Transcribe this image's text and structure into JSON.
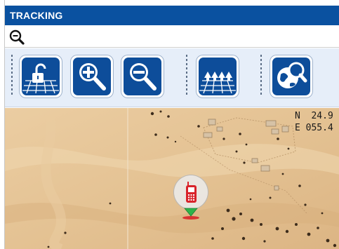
{
  "window": {
    "title": "TRACKING"
  },
  "search": {
    "icon": "magnifier-icon"
  },
  "toolbar": {
    "buttons": [
      {
        "name": "unlock-map-button",
        "icon": "unlock-grid-icon"
      },
      {
        "name": "zoom-in-button",
        "icon": "zoom-in-icon"
      },
      {
        "name": "zoom-out-button",
        "icon": "zoom-out-icon"
      },
      {
        "name": "group-view-button",
        "icon": "group-grid-icon"
      },
      {
        "name": "globe-search-button",
        "icon": "globe-search-icon"
      }
    ]
  },
  "map": {
    "coords": {
      "north": "N  24.9",
      "east": "E 055.4"
    },
    "marker": {
      "icon": "mobile-phone-icon",
      "status_color": "#2db34a"
    }
  },
  "colors": {
    "titlebar": "#0a51a0",
    "toolbar_bg": "#e6eef9",
    "icon_blue": "#0d4d9a",
    "sand": "#e6c69a"
  }
}
